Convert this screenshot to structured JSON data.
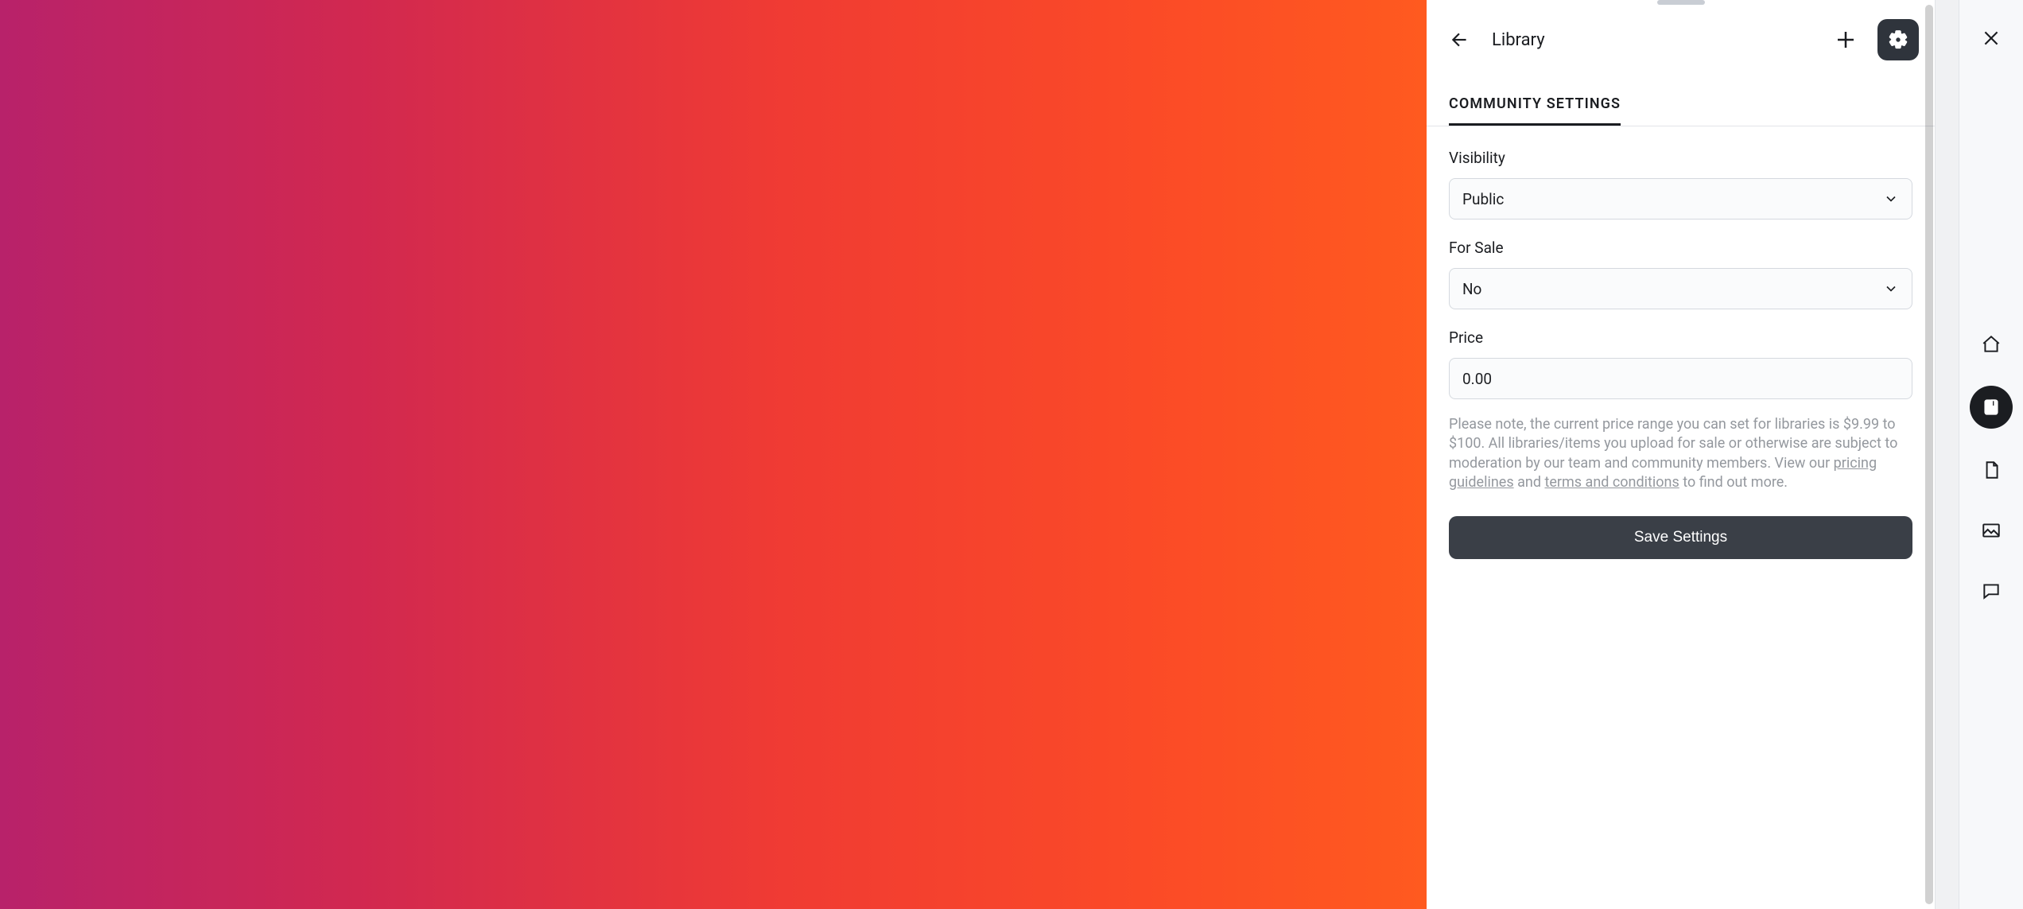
{
  "header": {
    "title": "Library"
  },
  "tabs": {
    "active": "COMMUNITY SETTINGS"
  },
  "form": {
    "visibility": {
      "label": "Visibility",
      "value": "Public"
    },
    "for_sale": {
      "label": "For Sale",
      "value": "No"
    },
    "price": {
      "label": "Price",
      "value": "0.00"
    },
    "note": {
      "pre": "Please note, the current price range you can set for libraries is $9.99 to $100. All libraries/items you upload for sale or otherwise are subject to moderation by our team and community members. View our ",
      "link1": "pricing guidelines",
      "mid": " and ",
      "link2": "terms and conditions",
      "post": " to find out more."
    },
    "save_label": "Save Settings"
  },
  "rail": {
    "items": [
      "home",
      "library",
      "document",
      "image",
      "comment"
    ]
  }
}
